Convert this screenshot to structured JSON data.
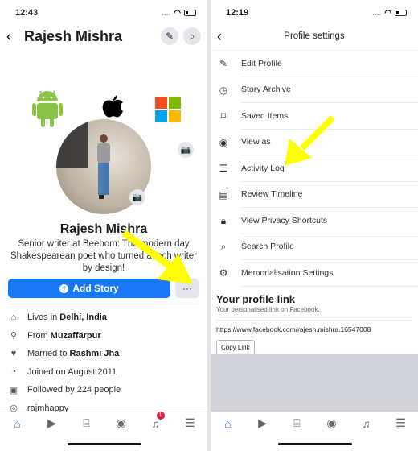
{
  "left": {
    "status": {
      "time": "12:43"
    },
    "header": {
      "title": "Rajesh Mishra",
      "back_icon": "‹"
    },
    "profile": {
      "name": "Rajesh Mishra",
      "bio": "Senior writer at Beebom: The modern day Shakespearean poet who turned a tech writer by design!",
      "add_story_label": "Add Story",
      "more_label": "···"
    },
    "info": [
      {
        "icon": "home-icon",
        "prefix": "Lives in",
        "value": "Delhi, India"
      },
      {
        "icon": "location-pin-icon",
        "prefix": "From",
        "value": "Muzaffarpur"
      },
      {
        "icon": "heart-icon",
        "prefix": "Married to",
        "value": "Rashmi Jha"
      },
      {
        "icon": "clock-icon",
        "prefix": "Joined on August 2011",
        "value": ""
      },
      {
        "icon": "followers-icon",
        "prefix": "Followed by 224 people",
        "value": ""
      },
      {
        "icon": "instagram-icon",
        "prefix": "rajmhappy",
        "value": ""
      }
    ],
    "notification_badge": "1"
  },
  "right": {
    "status": {
      "time": "12:19"
    },
    "header": {
      "title": "Profile settings",
      "back_icon": "‹"
    },
    "items": [
      {
        "icon": "pencil-icon",
        "label": "Edit Profile"
      },
      {
        "icon": "story-archive-icon",
        "label": "Story Archive"
      },
      {
        "icon": "bookmark-icon",
        "label": "Saved Items"
      },
      {
        "icon": "eye-icon",
        "label": "View as"
      },
      {
        "icon": "list-icon",
        "label": "Activity Log"
      },
      {
        "icon": "review-timeline-icon",
        "label": "Review Timeline"
      },
      {
        "icon": "lock-icon",
        "label": "View Privacy Shortcuts"
      },
      {
        "icon": "search-icon",
        "label": "Search Profile"
      },
      {
        "icon": "memorialisation-icon",
        "label": "Memorialisation Settings"
      }
    ],
    "profile_link": {
      "title": "Your profile link",
      "subtitle": "Your personalised link on Facebook.",
      "url": "https://www.facebook.com/rajesh.mishra.16547008",
      "copy_label": "Copy Link"
    }
  },
  "colors": {
    "accent": "#1877f2",
    "arrow": "#ffff00",
    "badge": "#e41e3f"
  }
}
